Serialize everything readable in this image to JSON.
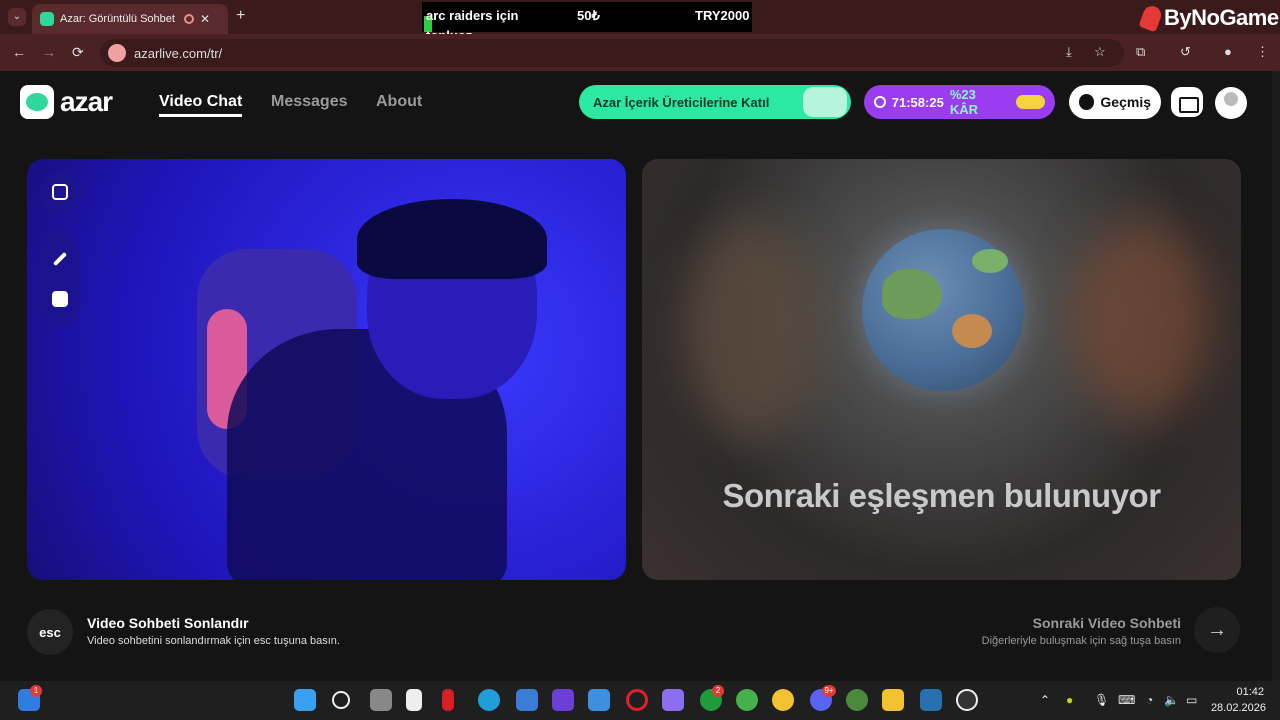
{
  "browser": {
    "tab_title": "Azar: Görüntülü Sohbet & Vi",
    "tab_close": "✕",
    "new_tab": "+",
    "url": "azarlive.com/tr/",
    "back": "←",
    "forward": "→",
    "reload": "⟳"
  },
  "overlay": {
    "line1": "arc raiders için",
    "line2": "topluoz",
    "price1": "50₺",
    "price2": "TRY2000",
    "brand": "ByNoGame"
  },
  "nav": {
    "logo": "azar",
    "items": [
      {
        "label": "Video Chat",
        "active": true
      },
      {
        "label": "Messages",
        "active": false
      },
      {
        "label": "About",
        "active": false
      }
    ],
    "creator_label": "Azar İçerik Üreticilerine Katıl",
    "promo_timer": "71:58:25",
    "promo_discount": "%23 KÂR",
    "history_label": "Geçmiş"
  },
  "video": {
    "finding_text": "Sonraki eşleşmen bulunuyor"
  },
  "bottom": {
    "esc_key": "esc",
    "end_title": "Video Sohbeti Sonlandır",
    "end_sub": "Video sohbetini sonlandırmak için esc tuşuna basın.",
    "next_title": "Sonraki Video Sohbeti",
    "next_sub": "Diğerleriyle buluşmak için sağ tuşa basın",
    "next_arrow": "→"
  },
  "taskbar": {
    "time": "01:42",
    "date": "28.02.2026",
    "badges": {
      "widgets": "1",
      "xbox": "2",
      "discord": "9+"
    }
  },
  "colors": {
    "accent_green": "#2be8a3",
    "promo_purple": "#9a3cf0",
    "browser_frame": "#3b1a1c"
  }
}
